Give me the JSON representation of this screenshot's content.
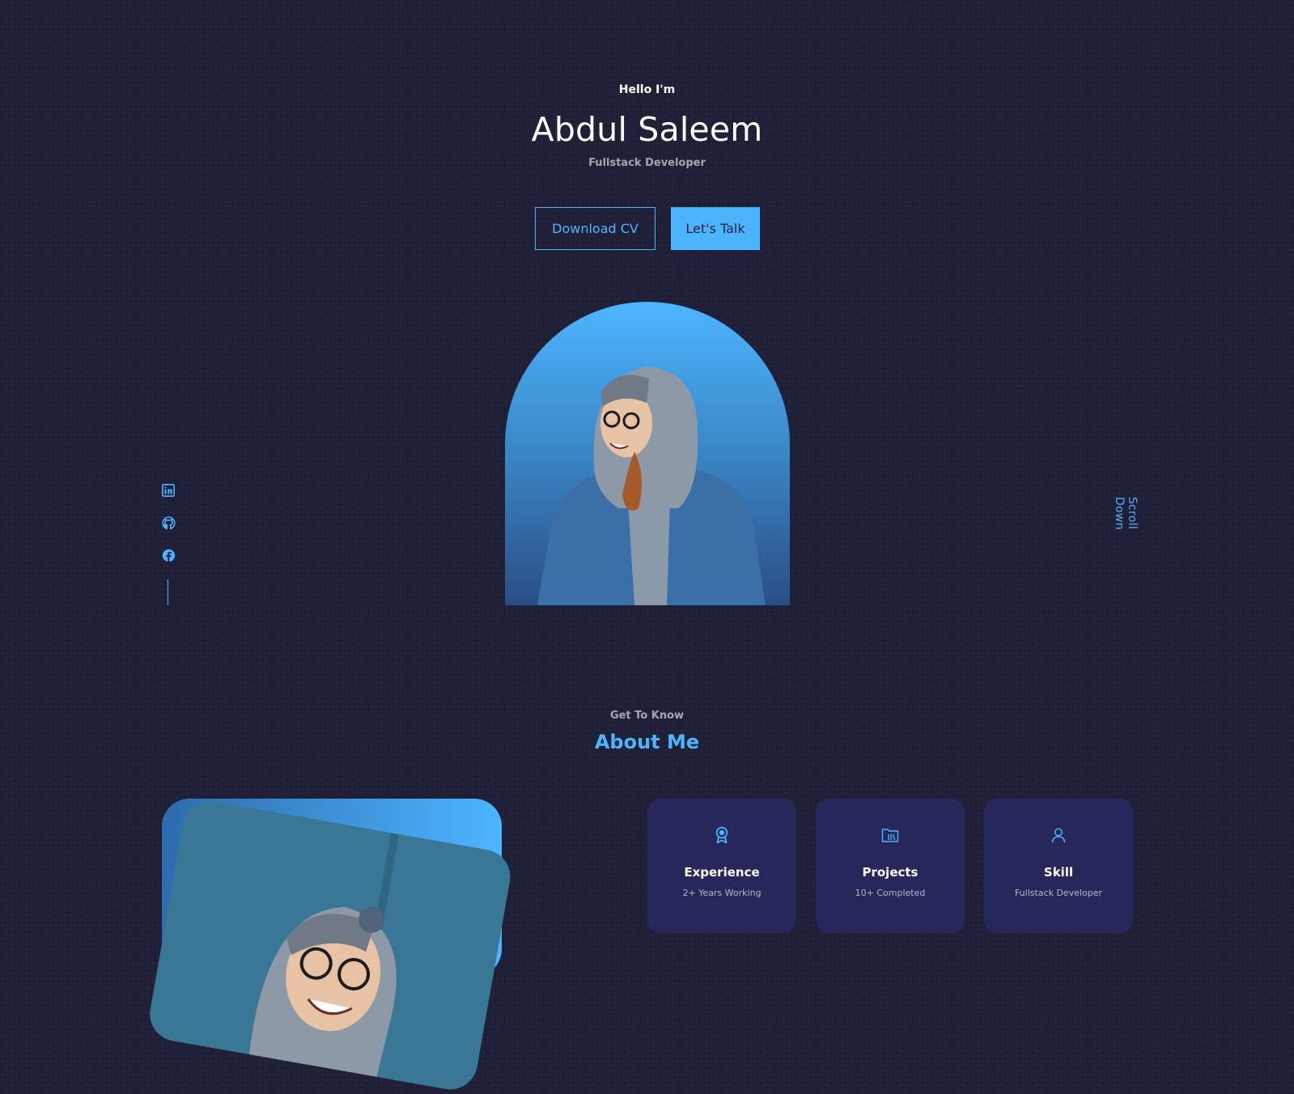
{
  "colors": {
    "background": "#1f1f38",
    "accent": "#4db5ff",
    "card": "#26275a",
    "text": "#ffffff",
    "muted": "rgba(255,255,255,0.6)"
  },
  "hero": {
    "greeting": "Hello I'm",
    "name": "Abdul Saleem",
    "role": "Fullstack Developer",
    "download_cv_label": "Download CV",
    "lets_talk_label": "Let's Talk"
  },
  "socials": [
    {
      "icon": "linkedin-icon"
    },
    {
      "icon": "github-icon"
    },
    {
      "icon": "facebook-icon"
    }
  ],
  "scroll_down_label": "Scroll Down",
  "about": {
    "eyebrow": "Get To Know",
    "title": "About Me",
    "cards": [
      {
        "icon": "award-icon",
        "title": "Experience",
        "subtitle": "2+ Years Working"
      },
      {
        "icon": "folder-icon",
        "title": "Projects",
        "subtitle": "10+ Completed"
      },
      {
        "icon": "user-icon",
        "title": "Skill",
        "subtitle": "Fullstack Developer"
      }
    ]
  }
}
